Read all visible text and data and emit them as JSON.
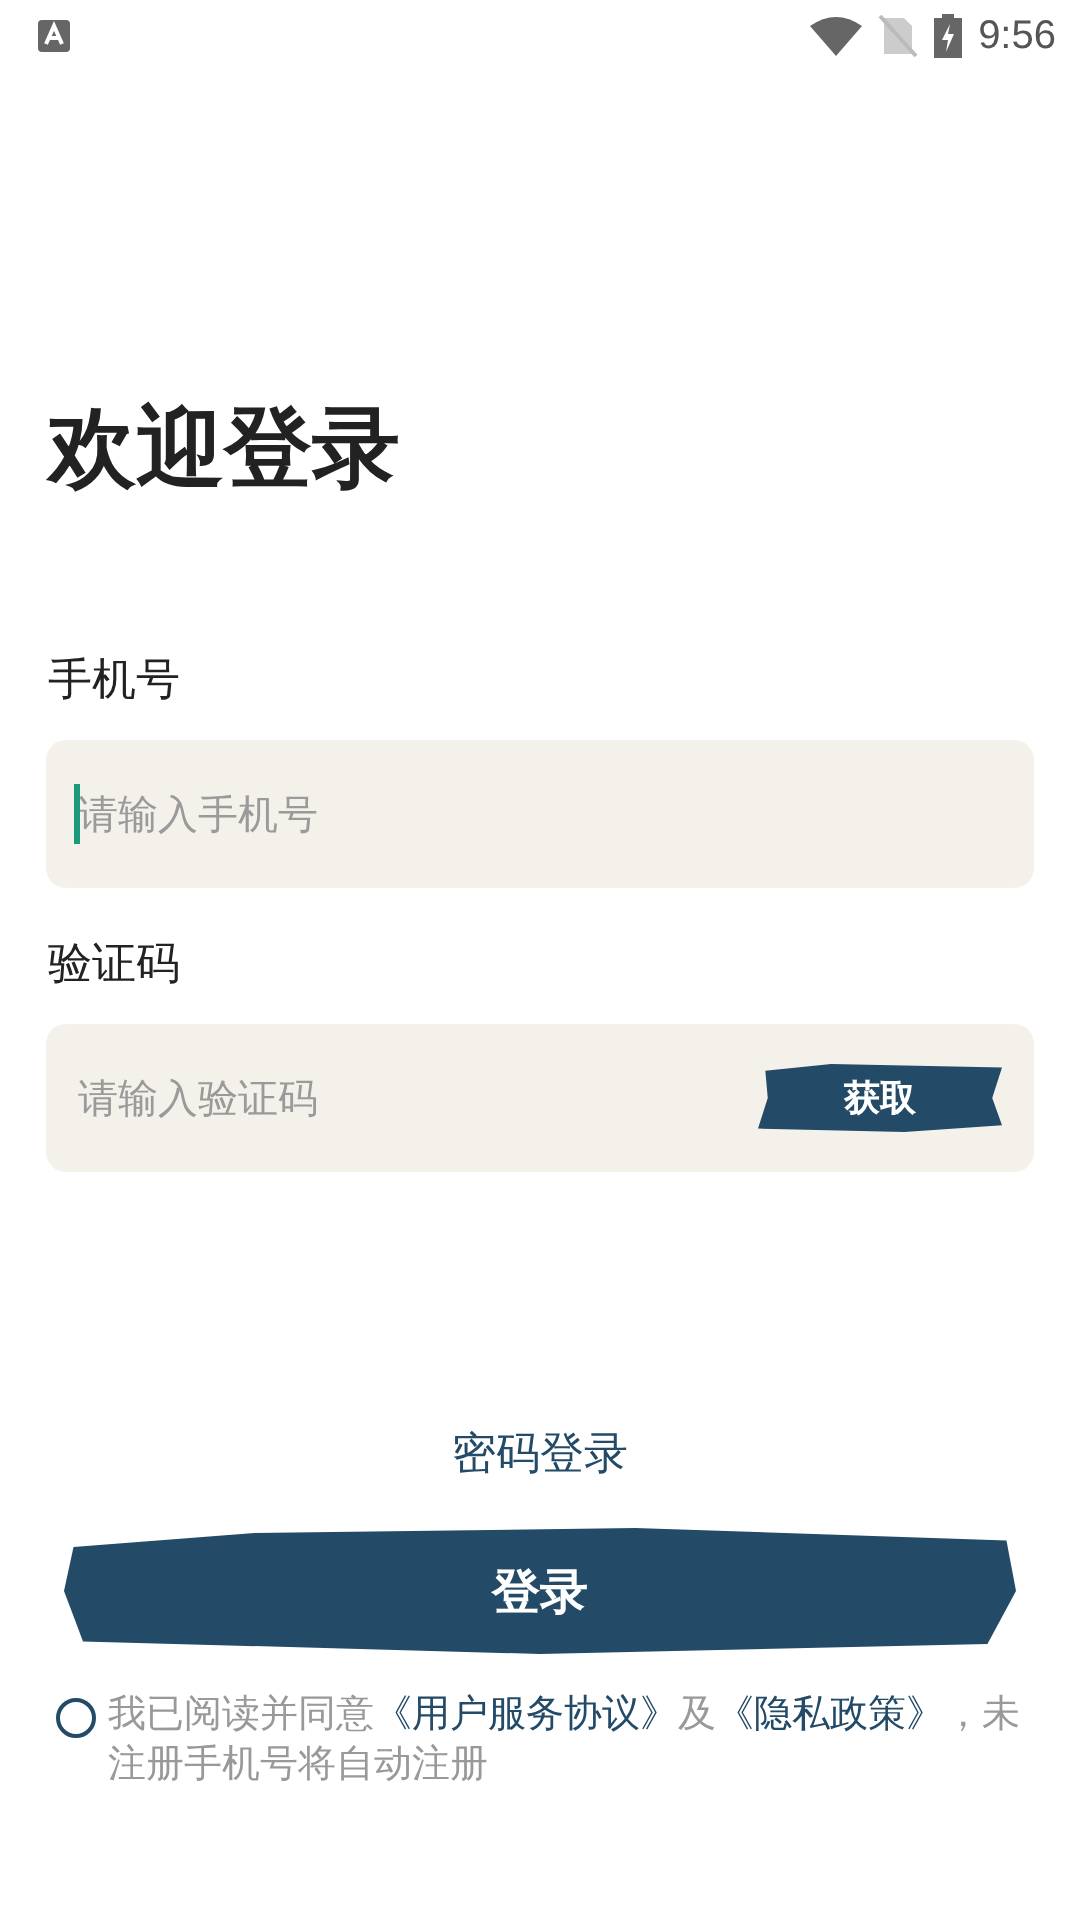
{
  "status_bar": {
    "time": "9:56"
  },
  "title": "欢迎登录",
  "fields": [
    {
      "label": "手机号",
      "placeholder": "请输入手机号",
      "focused": true
    },
    {
      "label": "验证码",
      "placeholder": "请输入验证码",
      "focused": false,
      "button": "获取"
    }
  ],
  "password_login": "密码登录",
  "login_button": "登录",
  "agreement": {
    "checked": false,
    "parts": [
      {
        "kind": "plain",
        "text": "我已阅读并同意"
      },
      {
        "kind": "link",
        "text": "《用户服务协议》"
      },
      {
        "kind": "plain",
        "text": "及"
      },
      {
        "kind": "link",
        "text": "《隐私政策》"
      },
      {
        "kind": "plain",
        "text": "，未注册手机号将自动注册"
      }
    ]
  }
}
